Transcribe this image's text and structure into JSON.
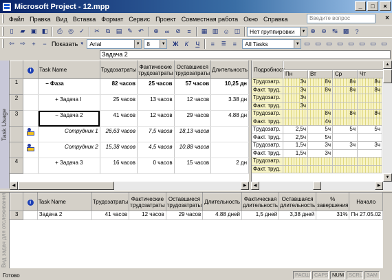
{
  "window": {
    "title": "Microsoft Project - 12.mpp"
  },
  "menu": {
    "items": [
      "Файл",
      "Правка",
      "Вид",
      "Вставка",
      "Формат",
      "Сервис",
      "Проект",
      "Совместная работа",
      "Окно",
      "Справка"
    ],
    "help_placeholder": "Введите вопрос"
  },
  "toolbar": {
    "grouping": "Нет группировки",
    "show_label": "Показать",
    "font": "Arial",
    "font_size": "8",
    "bold": "Ж",
    "italic": "К",
    "underline": "Ч",
    "filter": "All Tasks",
    "icons": [
      "new-icon",
      "open-icon",
      "save-icon",
      "publish-icon",
      "print-icon",
      "print-preview-icon",
      "spelling-icon",
      "cut-icon",
      "copy-icon",
      "paste-icon",
      "format-painter-icon",
      "undo-icon",
      "hyperlink-icon",
      "link-tasks-icon",
      "unlink-tasks-icon",
      "split-task-icon",
      "task-info-icon",
      "notes-icon",
      "assign-resources-icon",
      "publish-web-icon"
    ]
  },
  "entry": {
    "value": "Задача 2"
  },
  "side_labels": {
    "top": "Task Usage",
    "bottom": "Вид задач для отслеживания"
  },
  "top_grid": {
    "headers": [
      "",
      "",
      "Task Name",
      "Трудозатраты",
      "Фактические трудозатраты",
      "Оставшиеся трудозатраты",
      "Длительность"
    ],
    "rows": [
      {
        "id": "1",
        "indicator": "",
        "name": "Фаза",
        "outline": "−",
        "work": "82 часов",
        "actual": "25 часов",
        "remaining": "57 часов",
        "duration": "10,25 дн",
        "type": "summary"
      },
      {
        "id": "2",
        "indicator": "",
        "name": "Задача I",
        "outline": "+",
        "work": "25 часов",
        "actual": "13 часов",
        "remaining": "12 часов",
        "duration": "3.38 дн",
        "type": "task"
      },
      {
        "id": "3",
        "indicator": "",
        "name": "Задача 2",
        "outline": "−",
        "work": "41 часов",
        "actual": "12 часов",
        "remaining": "29 часов",
        "duration": "4.88 дн",
        "type": "task-selected"
      },
      {
        "id": "",
        "indicator": "resource",
        "name": "Сотрудник 1",
        "outline": "",
        "work": "26,63 часов",
        "actual": "7,5 часов",
        "remaining": "18,13 часов",
        "duration": "",
        "type": "assignment"
      },
      {
        "id": "",
        "indicator": "resource",
        "name": "Сотрудник 2",
        "outline": "",
        "work": "15,38 часов",
        "actual": "4,5 часов",
        "remaining": "10,88 часов",
        "duration": "",
        "type": "assignment"
      },
      {
        "id": "4",
        "indicator": "",
        "name": "Задача 3",
        "outline": "+",
        "work": "16 часов",
        "actual": "0 часов",
        "remaining": "15 часов",
        "duration": "2 дн",
        "type": "task"
      }
    ]
  },
  "usage": {
    "details_header": "Подробност",
    "days": [
      "Пн",
      "Вт",
      "Ср",
      "Чт"
    ],
    "rows": [
      {
        "label": "Трудозатр.",
        "values": [
          "3ч",
          "8ч",
          "8ч",
          "8ч"
        ],
        "yellow": true
      },
      {
        "label": "Факт. труд.",
        "values": [
          "3ч",
          "8ч",
          "8ч",
          "8ч"
        ],
        "yellow": true
      },
      {
        "label": "Трудозатр.",
        "values": [
          "3ч",
          "",
          "",
          ""
        ],
        "yellow": true
      },
      {
        "label": "Факт. труд.",
        "values": [
          "3ч",
          "",
          "",
          ""
        ],
        "yellow": true
      },
      {
        "label": "Трудозатр.",
        "values": [
          "",
          "8ч",
          "8ч",
          "8ч"
        ],
        "yellow": true
      },
      {
        "label": "Факт. труд.",
        "values": [
          "",
          "4ч",
          "",
          ""
        ],
        "yellow": true
      },
      {
        "label": "Трудозатр.",
        "values": [
          "2,5ч",
          "5ч",
          "5ч",
          "5ч"
        ],
        "yellow": false
      },
      {
        "label": "Факт. труд.",
        "values": [
          "2,5ч",
          "5ч",
          "",
          ""
        ],
        "yellow": false
      },
      {
        "label": "Трудозатр.",
        "values": [
          "1,5ч",
          "3ч",
          "3ч",
          "3ч"
        ],
        "yellow": false
      },
      {
        "label": "Факт. труд.",
        "values": [
          "1,5ч",
          "3ч",
          "",
          ""
        ],
        "yellow": false
      },
      {
        "label": "Трудозатр.",
        "values": [
          "",
          "",
          "",
          ""
        ],
        "yellow": true
      },
      {
        "label": "Факт. труд.",
        "values": [
          "",
          "",
          "",
          ""
        ],
        "yellow": true
      }
    ]
  },
  "bottom_grid": {
    "headers": [
      "",
      "",
      "Task Name",
      "Трудозатраты",
      "Фактические трудозатраты",
      "Оставшиеся трудозатраты",
      "Длительность",
      "Фактическая длительность",
      "Оставшаяся длительность",
      "% завершения",
      "Начало"
    ],
    "row": {
      "id": "3",
      "name": "Задача 2",
      "work": "41 часов",
      "actual": "12 часов",
      "remaining": "29 часов",
      "duration": "4.88 дней",
      "actual_duration": "1,5 дней",
      "remaining_duration": "3,38 дней",
      "percent": "31%",
      "start": "Пн 27.05.02"
    }
  },
  "status": {
    "text": "Готово",
    "indicators": [
      "РАСШ",
      "CAPS",
      "NUM",
      "SCRL",
      "ЗАМ"
    ],
    "active": "NUM"
  }
}
